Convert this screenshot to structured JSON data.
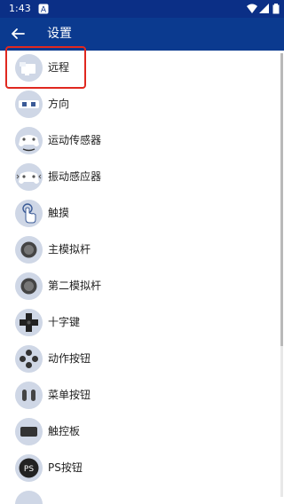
{
  "status_bar": {
    "time": "1:43",
    "app_badge": "A"
  },
  "app_bar": {
    "title": "设置",
    "back_icon": "arrow-left-icon"
  },
  "settings_items": [
    {
      "label": "远程",
      "icon": "remote-icon"
    },
    {
      "label": "方向",
      "icon": "orientation-icon"
    },
    {
      "label": "运动传感器",
      "icon": "motion-sensor-icon"
    },
    {
      "label": "振动感应器",
      "icon": "vibration-sensor-icon"
    },
    {
      "label": "触摸",
      "icon": "touch-icon"
    },
    {
      "label": "主模拟杆",
      "icon": "analog-stick-icon"
    },
    {
      "label": "第二模拟杆",
      "icon": "second-analog-stick-icon"
    },
    {
      "label": "十字键",
      "icon": "dpad-icon"
    },
    {
      "label": "动作按钮",
      "icon": "action-buttons-icon"
    },
    {
      "label": "菜单按钮",
      "icon": "menu-buttons-icon"
    },
    {
      "label": "触控板",
      "icon": "touchpad-icon"
    },
    {
      "label": "PS按钮",
      "icon": "ps-button-icon",
      "icon_text": "PS"
    },
    {
      "label": "",
      "icon": "partial-icon"
    }
  ],
  "colors": {
    "app_bar": "#0b3a8f",
    "status_bar": "#0b2f86",
    "highlight": "#e0281f",
    "icon_bg": "#cfd7e6"
  }
}
